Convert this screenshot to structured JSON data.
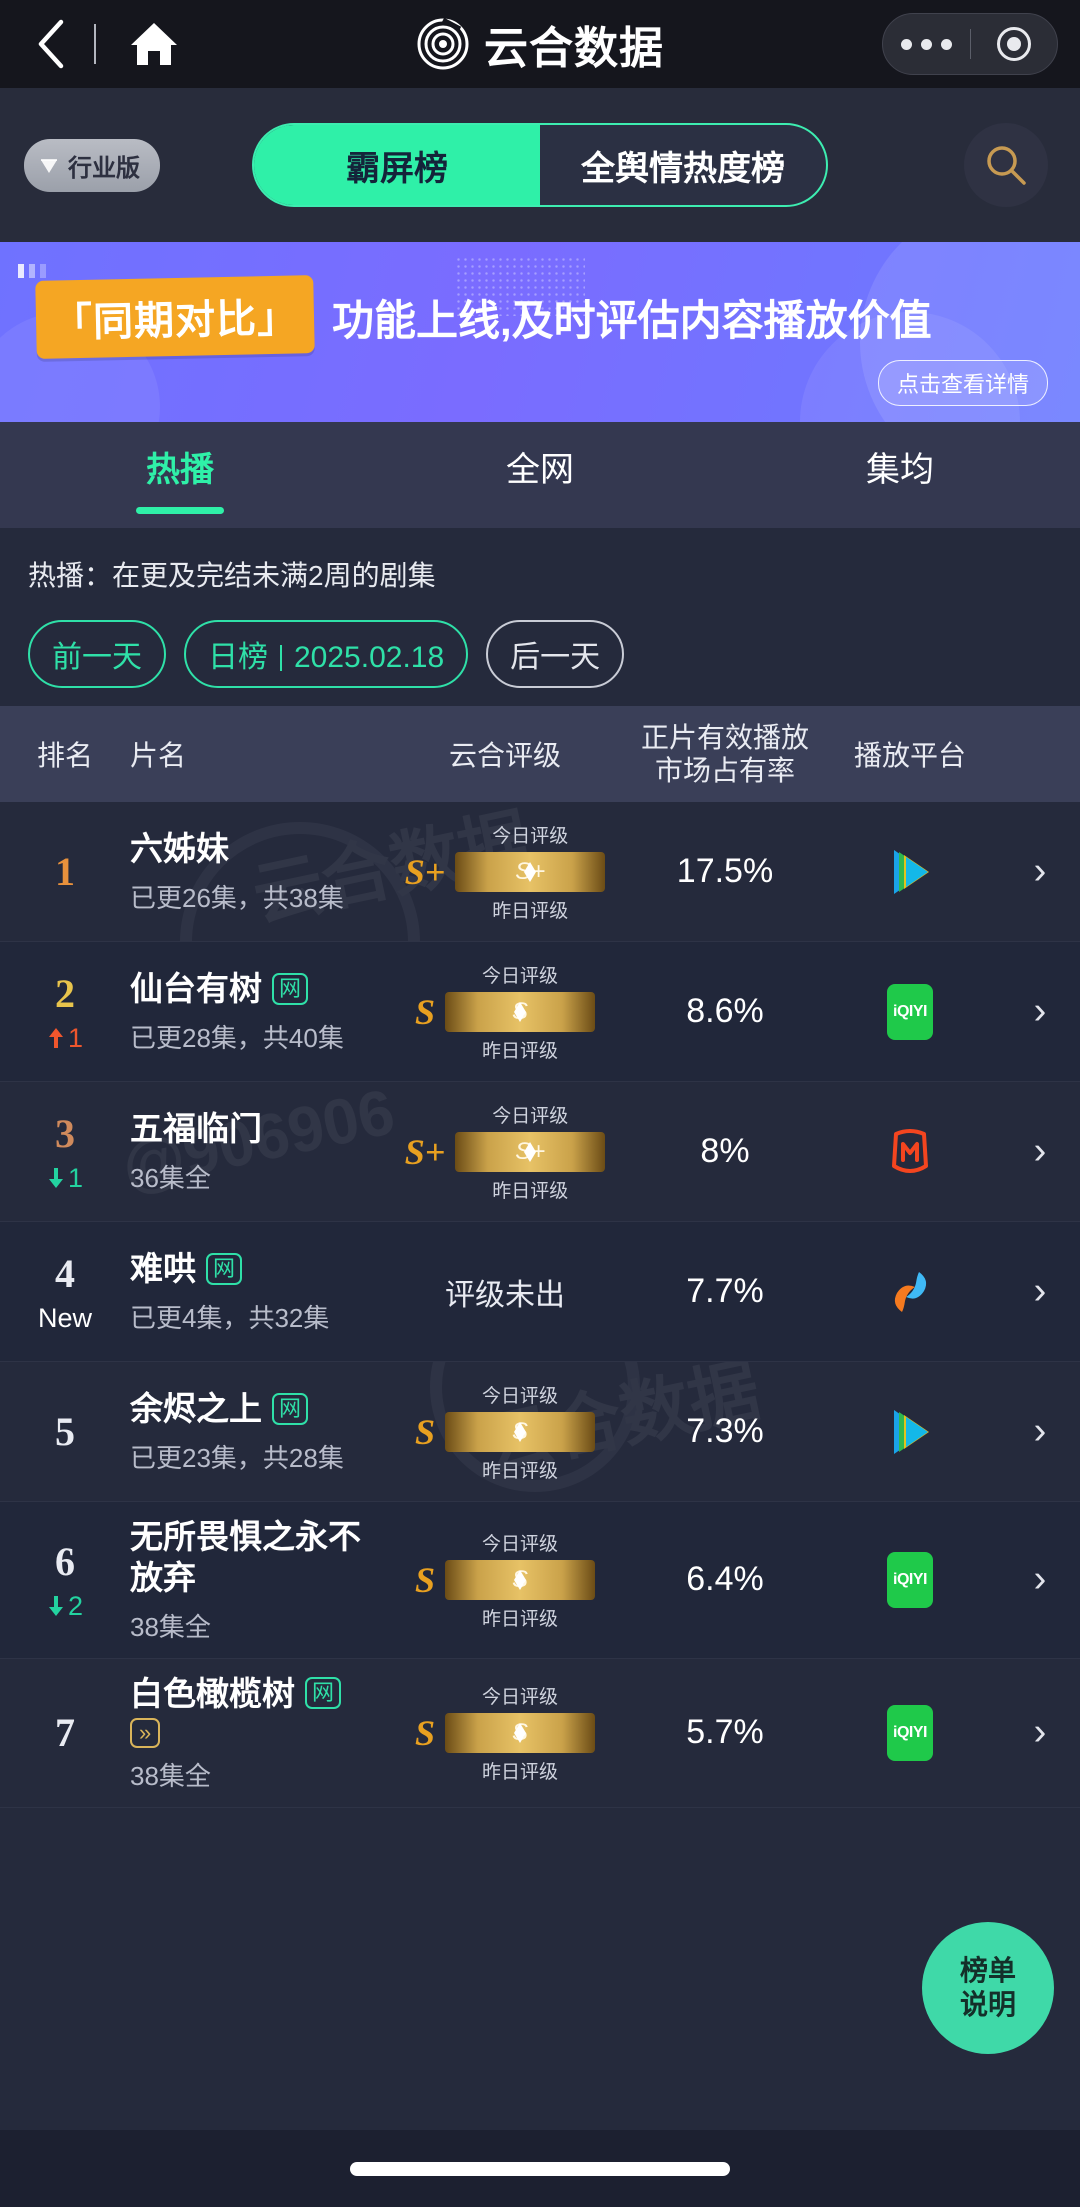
{
  "topbar": {
    "back_icon": "chevron-left-icon",
    "home_icon": "home-icon",
    "brand_title": "云合数据",
    "more_icon": "more-dots-icon",
    "close_icon": "target-circle-icon"
  },
  "subnav": {
    "industry_badge": "行业版",
    "segments": [
      {
        "label": "霸屏榜",
        "active": true
      },
      {
        "label": "全舆情热度榜",
        "active": false
      }
    ],
    "search_icon": "search-icon",
    "accent": "#2ff0a8"
  },
  "banner": {
    "tag": "「同期对比」",
    "headline": "功能上线,及时评估内容播放价值",
    "cta": "点击查看详情",
    "background": "#7072ff"
  },
  "main_tabs": [
    {
      "label": "热播",
      "active": true
    },
    {
      "label": "全网",
      "active": false
    },
    {
      "label": "集均",
      "active": false
    }
  ],
  "filters": {
    "description": "热播：在更及完结未满2周的剧集",
    "prev_day": "前一天",
    "period_label": "日榜",
    "date": "2025.02.18",
    "next_day": "后一天"
  },
  "table": {
    "headers": {
      "rank": "排名",
      "title": "片名",
      "rating": "云合评级",
      "share_line1": "正片有效播放",
      "share_line2": "市场占有率",
      "platform": "播放平台"
    },
    "rating_labels": {
      "today": "今日评级",
      "yesterday": "昨日评级"
    },
    "rows": [
      {
        "rank": "1",
        "rank_color": "#e8913c",
        "delta": "",
        "delta_dir": "none",
        "is_new": false,
        "title": "六姊妹",
        "net_badge": false,
        "fwd_badge": false,
        "episodes": "已更26集，共38集",
        "rating": "S+",
        "rating_bar": "S+",
        "rating_pending": "",
        "share": "17.5%",
        "platform": "tencent-video-icon",
        "arrow": "›"
      },
      {
        "rank": "2",
        "rank_color": "#e8c44c",
        "delta": "1",
        "delta_dir": "up",
        "is_new": false,
        "title": "仙台有树",
        "net_badge": true,
        "fwd_badge": false,
        "episodes": "已更28集，共40集",
        "rating": "S",
        "rating_bar": "S",
        "rating_pending": "",
        "share": "8.6%",
        "platform": "iqiyi-icon",
        "arrow": "›"
      },
      {
        "rank": "3",
        "rank_color": "#d08a5c",
        "delta": "1",
        "delta_dir": "down",
        "is_new": false,
        "title": "五福临门",
        "net_badge": false,
        "fwd_badge": false,
        "episodes": "36集全",
        "rating": "S+",
        "rating_bar": "S+",
        "rating_pending": "",
        "share": "8%",
        "platform": "mango-tv-icon",
        "arrow": "›"
      },
      {
        "rank": "4",
        "rank_color": "#e9ebf2",
        "delta": "",
        "delta_dir": "none",
        "is_new": true,
        "new_label": "New",
        "title": "难哄",
        "net_badge": true,
        "fwd_badge": false,
        "episodes": "已更4集，共32集",
        "rating": "",
        "rating_bar": "",
        "rating_pending": "评级未出",
        "share": "7.7%",
        "platform": "youku-icon",
        "arrow": "›"
      },
      {
        "rank": "5",
        "rank_color": "#e9ebf2",
        "delta": "",
        "delta_dir": "none",
        "is_new": false,
        "title": "余烬之上",
        "net_badge": true,
        "fwd_badge": false,
        "episodes": "已更23集，共28集",
        "rating": "S",
        "rating_bar": "S",
        "rating_pending": "",
        "share": "7.3%",
        "platform": "tencent-video-icon",
        "arrow": "›"
      },
      {
        "rank": "6",
        "rank_color": "#e9ebf2",
        "delta": "2",
        "delta_dir": "down",
        "is_new": false,
        "title": "无所畏惧之永不放弃",
        "net_badge": false,
        "fwd_badge": false,
        "episodes": "38集全",
        "rating": "S",
        "rating_bar": "S",
        "rating_pending": "",
        "share": "6.4%",
        "platform": "iqiyi-icon",
        "arrow": "›"
      },
      {
        "rank": "7",
        "rank_color": "#e9ebf2",
        "delta": "",
        "delta_dir": "none",
        "is_new": false,
        "title": "白色橄榄树",
        "net_badge": true,
        "fwd_badge": true,
        "episodes": "38集全",
        "rating": "S",
        "rating_bar": "S",
        "rating_pending": "",
        "share": "5.7%",
        "platform": "iqiyi-icon",
        "arrow": "›"
      }
    ]
  },
  "fab": {
    "line1": "榜单",
    "line2": "说明"
  },
  "watermarks": [
    "云合数据",
    "@906906",
    "云合数据"
  ]
}
